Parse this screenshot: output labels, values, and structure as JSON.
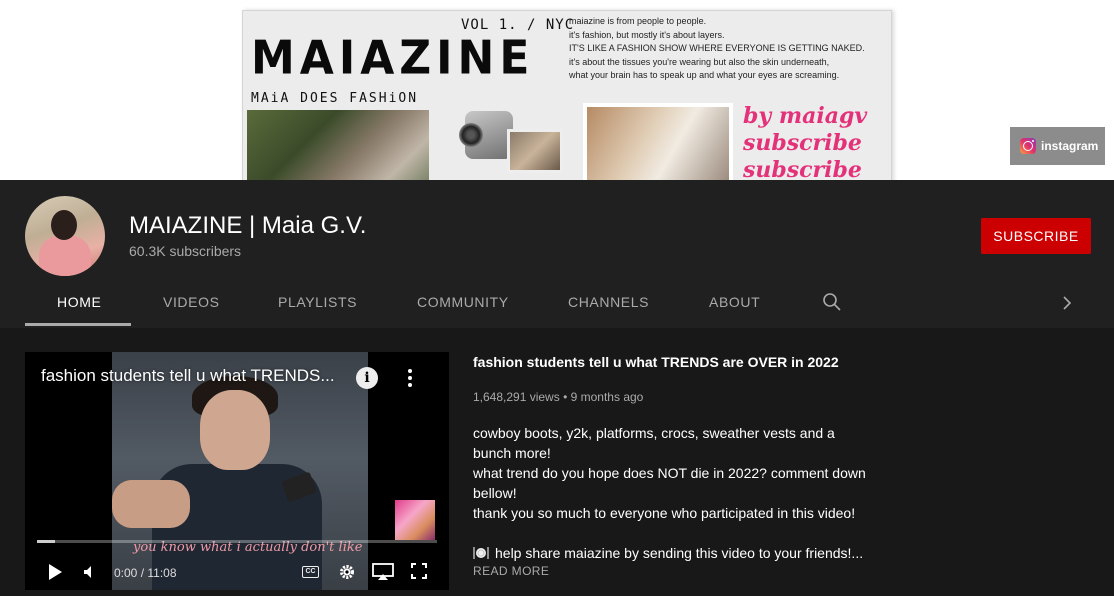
{
  "banner": {
    "vol": "VOL 1. / NYC",
    "logo": "MAIAZINE",
    "subtitle": "MAiA DOES FASHiON",
    "blurb": [
      "maiazine is from people to people.",
      " it's fashion, but mostly it's about layers.",
      "IT'S LIKE A FASHION SHOW WHERE EVERYONE IS GETTING NAKED.",
      "it's about the tissues you're wearing but also the skin underneath,",
      "what your brain has to speak up and what your eyes are screaming."
    ],
    "script_lines": [
      "by maiagv",
      "subscribe",
      "subscribe"
    ],
    "link_label": "instagram",
    "link_icon": "instagram-icon"
  },
  "channel": {
    "name": "MAIAZINE | Maia G.V.",
    "subscribers": "60.3K subscribers",
    "subscribe_label": "SUBSCRIBE",
    "subscribe_color": "#cc0000"
  },
  "tabs": [
    {
      "label": "HOME",
      "active": true
    },
    {
      "label": "VIDEOS",
      "active": false
    },
    {
      "label": "PLAYLISTS",
      "active": false
    },
    {
      "label": "COMMUNITY",
      "active": false
    },
    {
      "label": "CHANNELS",
      "active": false
    },
    {
      "label": "ABOUT",
      "active": false
    }
  ],
  "player": {
    "overlay_title": "fashion students tell u what TRENDS...",
    "caption": "you know what i actually don't like",
    "time": "0:00 / 11:08",
    "cc_label": "CC",
    "progress": 0.045
  },
  "video": {
    "title": "fashion students tell u what TRENDS are OVER in 2022",
    "views": "1,648,291 views",
    "age": "9 months ago",
    "separator": "•",
    "description_lines": [
      "cowboy boots, y2k, platforms, crocs, sweather vests and a",
      "bunch more!",
      "what trend do you hope does NOT die in 2022? comment down",
      "bellow!",
      "thank you so much to everyone who participated in this video!"
    ],
    "share_line": "help share maiazine by sending this video to your friends!...",
    "read_more": "READ MORE"
  }
}
